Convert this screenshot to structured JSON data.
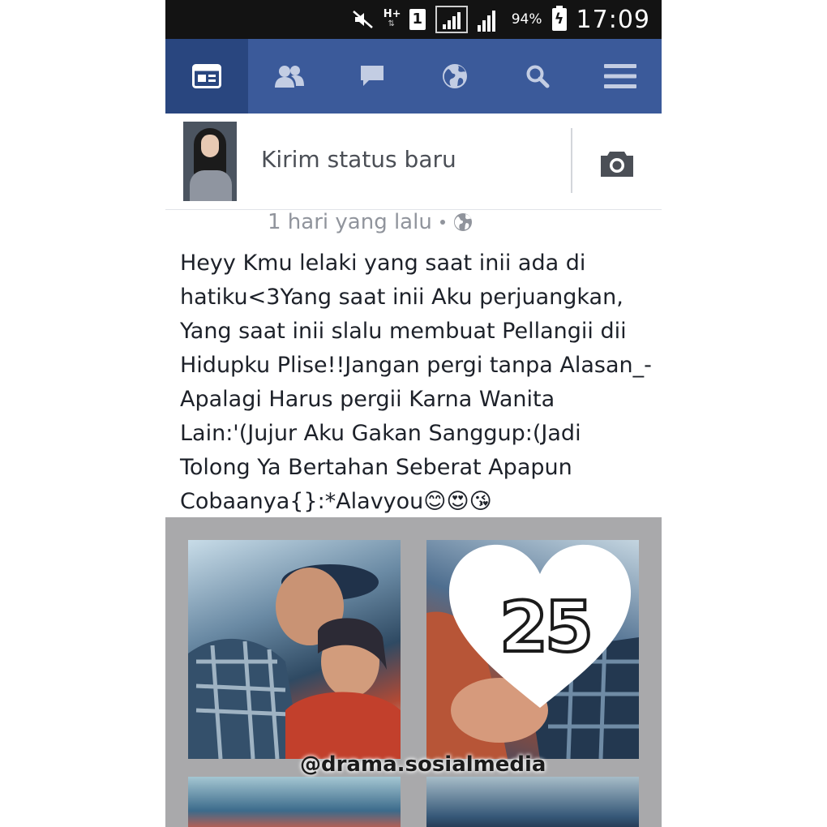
{
  "status_bar": {
    "network_type": "H+",
    "sim_slot": "1",
    "battery_percent": "94%",
    "time": "17:09"
  },
  "nav": {
    "items": [
      {
        "icon": "news-feed-icon",
        "active": true
      },
      {
        "icon": "friends-icon",
        "active": false
      },
      {
        "icon": "messages-icon",
        "active": false
      },
      {
        "icon": "notifications-globe-icon",
        "active": false
      },
      {
        "icon": "search-icon",
        "active": false
      },
      {
        "icon": "menu-icon",
        "active": false
      }
    ],
    "colors": {
      "bar": "#3b5a9a",
      "active": "#29467f"
    }
  },
  "composer": {
    "placeholder": "Kirim status baru",
    "camera_icon": "camera-icon"
  },
  "post": {
    "timestamp": "1 hari yang lalu",
    "privacy_icon": "globe-icon",
    "text": "Heyy Kmu lelaki yang saat inii ada di hatiku<3Yang saat inii Aku perjuangkan, Yang saat inii slalu membuat Pellangii dii Hidupku Plise!!Jangan pergi tanpa Alasan_-Apalagi Harus pergii Karna Wanita Lain:'(Jujur Aku Gakan Sanggup:(Jadi Tolong Ya Bertahan Seberat Apapun Cobaanya{}:*Alavyou😊😍😘"
  },
  "photo": {
    "sticker_number": "25",
    "watermark": "@drama.sosialmedia"
  }
}
